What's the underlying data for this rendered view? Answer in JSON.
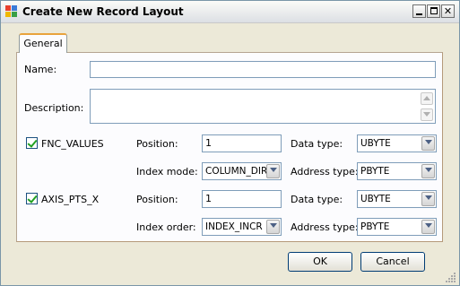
{
  "window": {
    "title": "Create New Record Layout"
  },
  "tabs": [
    {
      "label": "General"
    }
  ],
  "form": {
    "name_label": "Name:",
    "name_value": "",
    "description_label": "Description:",
    "description_value": "",
    "fnc": {
      "label": "FNC_VALUES",
      "checked": true,
      "position_label": "Position:",
      "position_value": "1",
      "data_type_label": "Data type:",
      "data_type_value": "UBYTE",
      "index_mode_label": "Index mode:",
      "index_mode_value": "COLUMN_DIR",
      "address_type_label": "Address type:",
      "address_type_value": "PBYTE"
    },
    "axis": {
      "label": "AXIS_PTS_X",
      "checked": true,
      "position_label": "Position:",
      "position_value": "1",
      "data_type_label": "Data type:",
      "data_type_value": "UBYTE",
      "index_order_label": "Index order:",
      "index_order_value": "INDEX_INCR",
      "address_type_label": "Address type:",
      "address_type_value": "PBYTE"
    }
  },
  "buttons": {
    "ok": "OK",
    "cancel": "Cancel"
  },
  "icons": {
    "app": "app-icon",
    "minimize": "minimize-icon",
    "maximize": "maximize-icon",
    "close": "close-icon",
    "dropdown": "chevron-down-icon",
    "check": "check-icon",
    "resize": "resize-grip-icon"
  }
}
